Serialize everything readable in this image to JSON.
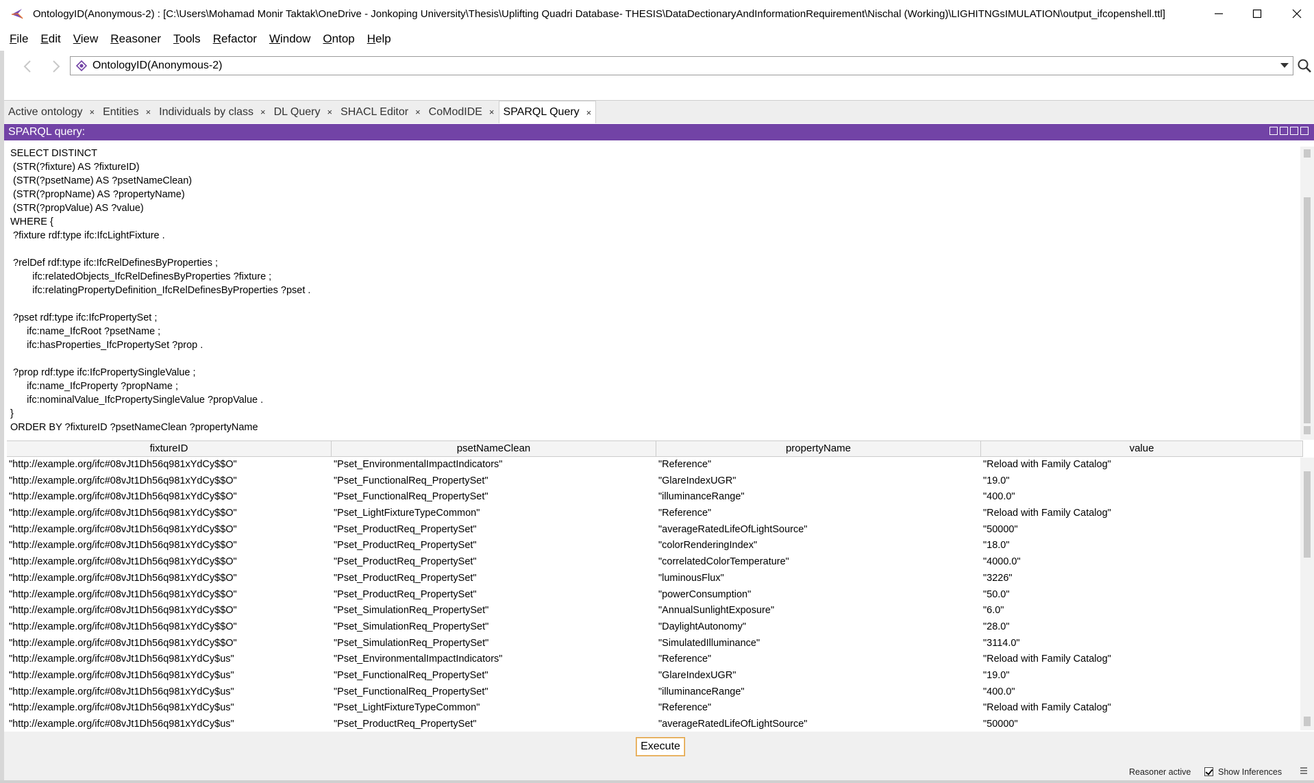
{
  "window": {
    "title": "OntologyID(Anonymous-2) : [C:\\Users\\Mohamad Monir Taktak\\OneDrive - Jonkoping University\\Thesis\\Uplifting Quadri Database- THESIS\\DataDectionaryAndInformationRequirement\\Nischal (Working)\\LIGHITNGsIMULATION\\output_ifcopenshell.ttl]",
    "icons": {
      "app": "protege-icon",
      "minimize": "minimize-icon",
      "maximize": "maximize-icon",
      "close": "close-icon"
    }
  },
  "menubar": {
    "items": [
      {
        "first": "F",
        "rest": "ile"
      },
      {
        "first": "E",
        "rest": "dit"
      },
      {
        "first": "V",
        "rest": "iew"
      },
      {
        "first": "R",
        "rest": "easoner"
      },
      {
        "first": "T",
        "rest": "ools"
      },
      {
        "first": "R",
        "rest": "efactor"
      },
      {
        "first": "W",
        "rest": "indow"
      },
      {
        "first": "O",
        "rest": "ntop"
      },
      {
        "first": "H",
        "rest": "elp"
      }
    ]
  },
  "nav": {
    "ontology_selector": "OntologyID(Anonymous-2)",
    "icons": {
      "back": "back-arrow-icon",
      "forward": "forward-arrow-icon",
      "search": "search-icon",
      "ontology": "ontology-icon"
    }
  },
  "tabs": [
    {
      "label": "Active ontology",
      "active": false
    },
    {
      "label": "Entities",
      "active": false
    },
    {
      "label": "Individuals by class",
      "active": false
    },
    {
      "label": "DL Query",
      "active": false
    },
    {
      "label": "SHACL Editor",
      "active": false
    },
    {
      "label": "CoModIDE",
      "active": false
    },
    {
      "label": "SPARQL Query",
      "active": true
    }
  ],
  "tab_close_glyph": "×",
  "panel": {
    "title": "SPARQL query:",
    "accent_color": "#7243a6"
  },
  "query_lines": [
    "SELECT DISTINCT",
    " (STR(?fixture) AS ?fixtureID)",
    " (STR(?psetName) AS ?psetNameClean)",
    " (STR(?propName) AS ?propertyName)",
    " (STR(?propValue) AS ?value)",
    "WHERE {",
    " ?fixture rdf:type ifc:IfcLightFixture .",
    "",
    " ?relDef rdf:type ifc:IfcRelDefinesByProperties ;",
    "        ifc:relatedObjects_IfcRelDefinesByProperties ?fixture ;",
    "        ifc:relatingPropertyDefinition_IfcRelDefinesByProperties ?pset .",
    "",
    " ?pset rdf:type ifc:IfcPropertySet ;",
    "      ifc:name_IfcRoot ?psetName ;",
    "      ifc:hasProperties_IfcPropertySet ?prop .",
    "",
    " ?prop rdf:type ifc:IfcPropertySingleValue ;",
    "      ifc:name_IfcProperty ?propName ;",
    "      ifc:nominalValue_IfcPropertySingleValue ?propValue .",
    "}",
    "ORDER BY ?fixtureID ?psetNameClean ?propertyName"
  ],
  "results": {
    "columns": [
      "fixtureID",
      "psetNameClean",
      "propertyName",
      "value"
    ],
    "rows": [
      [
        "\"http://example.org/ifc#08vJt1Dh56q981xYdCy$$O\"",
        "\"Pset_EnvironmentalImpactIndicators\"",
        "\"Reference\"",
        "\"Reload with Family Catalog\""
      ],
      [
        "\"http://example.org/ifc#08vJt1Dh56q981xYdCy$$O\"",
        "\"Pset_FunctionalReq_PropertySet\"",
        "\"GlareIndexUGR\"",
        "\"19.0\""
      ],
      [
        "\"http://example.org/ifc#08vJt1Dh56q981xYdCy$$O\"",
        "\"Pset_FunctionalReq_PropertySet\"",
        "\"illuminanceRange\"",
        "\"400.0\""
      ],
      [
        "\"http://example.org/ifc#08vJt1Dh56q981xYdCy$$O\"",
        "\"Pset_LightFixtureTypeCommon\"",
        "\"Reference\"",
        "\"Reload with Family Catalog\""
      ],
      [
        "\"http://example.org/ifc#08vJt1Dh56q981xYdCy$$O\"",
        "\"Pset_ProductReq_PropertySet\"",
        "\"averageRatedLifeOfLightSource\"",
        "\"50000\""
      ],
      [
        "\"http://example.org/ifc#08vJt1Dh56q981xYdCy$$O\"",
        "\"Pset_ProductReq_PropertySet\"",
        "\"colorRenderingIndex\"",
        "\"18.0\""
      ],
      [
        "\"http://example.org/ifc#08vJt1Dh56q981xYdCy$$O\"",
        "\"Pset_ProductReq_PropertySet\"",
        "\"correlatedColorTemperature\"",
        "\"4000.0\""
      ],
      [
        "\"http://example.org/ifc#08vJt1Dh56q981xYdCy$$O\"",
        "\"Pset_ProductReq_PropertySet\"",
        "\"luminousFlux\"",
        "\"3226\""
      ],
      [
        "\"http://example.org/ifc#08vJt1Dh56q981xYdCy$$O\"",
        "\"Pset_ProductReq_PropertySet\"",
        "\"powerConsumption\"",
        "\"50.0\""
      ],
      [
        "\"http://example.org/ifc#08vJt1Dh56q981xYdCy$$O\"",
        "\"Pset_SimulationReq_PropertySet\"",
        "\"AnnualSunlightExposure\"",
        "\"6.0\""
      ],
      [
        "\"http://example.org/ifc#08vJt1Dh56q981xYdCy$$O\"",
        "\"Pset_SimulationReq_PropertySet\"",
        "\"DaylightAutonomy\"",
        "\"28.0\""
      ],
      [
        "\"http://example.org/ifc#08vJt1Dh56q981xYdCy$$O\"",
        "\"Pset_SimulationReq_PropertySet\"",
        "\"SimulatedIlluminance\"",
        "\"3114.0\""
      ],
      [
        "\"http://example.org/ifc#08vJt1Dh56q981xYdCy$us\"",
        "\"Pset_EnvironmentalImpactIndicators\"",
        "\"Reference\"",
        "\"Reload with Family Catalog\""
      ],
      [
        "\"http://example.org/ifc#08vJt1Dh56q981xYdCy$us\"",
        "\"Pset_FunctionalReq_PropertySet\"",
        "\"GlareIndexUGR\"",
        "\"19.0\""
      ],
      [
        "\"http://example.org/ifc#08vJt1Dh56q981xYdCy$us\"",
        "\"Pset_FunctionalReq_PropertySet\"",
        "\"illuminanceRange\"",
        "\"400.0\""
      ],
      [
        "\"http://example.org/ifc#08vJt1Dh56q981xYdCy$us\"",
        "\"Pset_LightFixtureTypeCommon\"",
        "\"Reference\"",
        "\"Reload with Family Catalog\""
      ],
      [
        "\"http://example.org/ifc#08vJt1Dh56q981xYdCy$us\"",
        "\"Pset_ProductReq_PropertySet\"",
        "\"averageRatedLifeOfLightSource\"",
        "\"50000\""
      ]
    ]
  },
  "execute_label": "Execute",
  "status": {
    "reasoner": "Reasoner active",
    "show_inferences_label": "Show Inferences",
    "show_inferences_checked": true
  }
}
